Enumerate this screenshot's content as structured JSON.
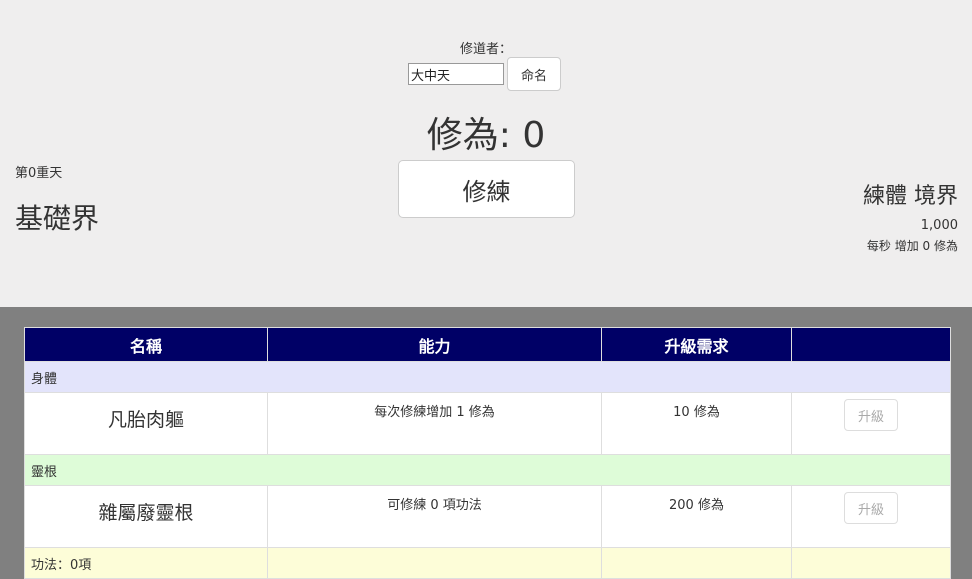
{
  "header": {
    "cultivator_label": "修道者：",
    "name_value": "大中天",
    "name_button": "命名",
    "cultivation_label": "修為: 0",
    "train_button": "修練"
  },
  "left_panel": {
    "heaven_level": "第0重天",
    "realm": "基礎界"
  },
  "right_panel": {
    "stage_title": "練體 境界",
    "next_requirement": "1,000",
    "rate": "每秒 增加 0 修為"
  },
  "table": {
    "headers": [
      "名稱",
      "能力",
      "升級需求",
      ""
    ],
    "categories": {
      "body": "身體",
      "root": "靈根",
      "techniques": "功法：0項"
    },
    "rows": [
      {
        "name": "凡胎肉軀",
        "ability": "每次修練增加 1 修為",
        "cost": "10 修為",
        "button": "升級"
      },
      {
        "name": "雜屬廢靈根",
        "ability": "可修練 0 項功法",
        "cost": "200 修為",
        "button": "升級"
      }
    ]
  },
  "colors": {
    "header_bg": "#000066",
    "body_category_bg": "#e3e4fb",
    "root_category_bg": "#defcd8",
    "technique_category_bg": "#fdfdd8",
    "page_bg": "#efeeee",
    "lower_bg": "#808080"
  }
}
